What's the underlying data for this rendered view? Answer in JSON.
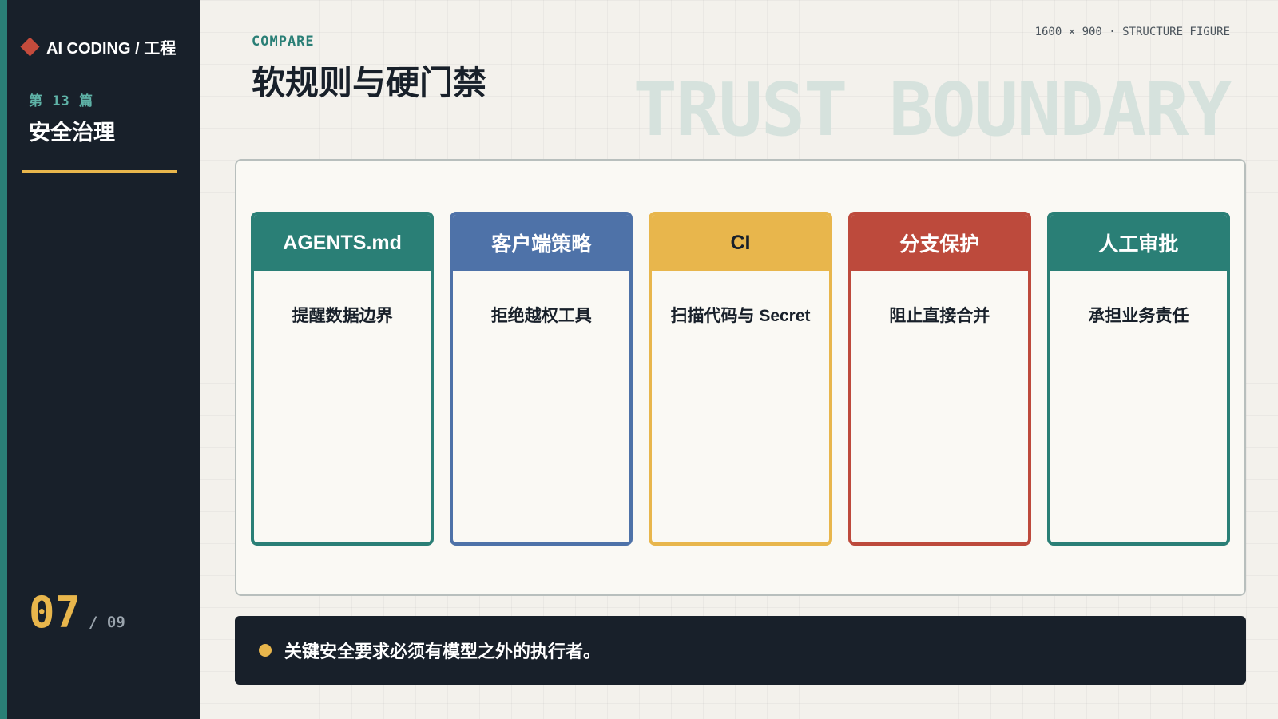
{
  "sidebar": {
    "brand": "AI CODING / 工程",
    "chapter_label": "第 13 篇",
    "chapter_title": "安全治理",
    "page_current": "07",
    "page_total": "/ 09"
  },
  "header": {
    "kicker": "COMPARE",
    "title": "软规则与硬门禁",
    "figure_meta": "1600 × 900 · STRUCTURE FIGURE",
    "watermark": "TRUST BOUNDARY"
  },
  "columns": [
    {
      "title": "AGENTS.md",
      "body": "提醒数据边界",
      "color": "#2a7f76",
      "text_color": "#ffffff"
    },
    {
      "title": "客户端策略",
      "body": "拒绝越权工具",
      "color": "#4e72a8",
      "text_color": "#ffffff"
    },
    {
      "title": "CI",
      "body": "扫描代码与 Secret",
      "color": "#e8b64c",
      "text_color": "#18202a"
    },
    {
      "title": "分支保护",
      "body": "阻止直接合并",
      "color": "#bd4a3c",
      "text_color": "#ffffff"
    },
    {
      "title": "人工审批",
      "body": "承担业务责任",
      "color": "#2a7f76",
      "text_color": "#ffffff"
    }
  ],
  "note": {
    "text": "关键安全要求必须有模型之外的执行者。"
  },
  "colors": {
    "sidebar_bg": "#18202a",
    "accent_teal": "#2a7f76",
    "accent_gold": "#e8b64c",
    "accent_red": "#c44b3c"
  }
}
